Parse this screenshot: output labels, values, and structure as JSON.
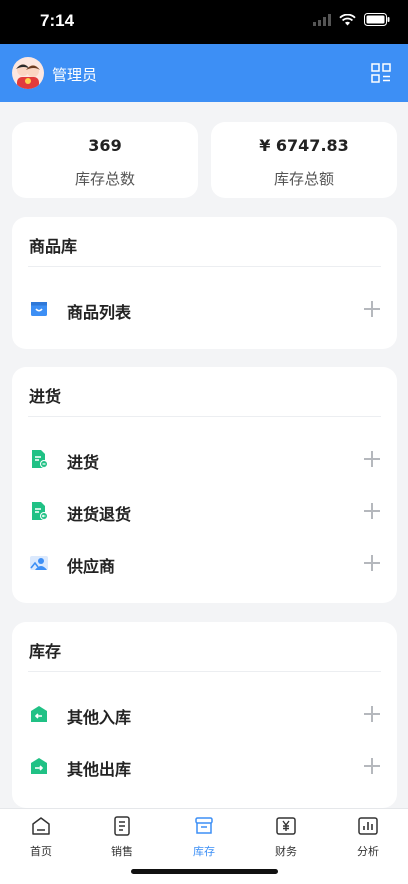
{
  "status_bar": {
    "time": "7:14"
  },
  "header": {
    "user_name": "管理员"
  },
  "summary": {
    "stock_total_value": "369",
    "stock_total_label": "库存总数",
    "stock_amount_value": "¥ 6747.83",
    "stock_amount_label": "库存总额"
  },
  "sections": [
    {
      "title": "商品库",
      "items": [
        {
          "label": "商品列表",
          "icon": "shopping-bag-icon"
        }
      ]
    },
    {
      "title": "进货",
      "items": [
        {
          "label": "进货",
          "icon": "purchase-doc-icon"
        },
        {
          "label": "进货退货",
          "icon": "purchase-return-doc-icon"
        },
        {
          "label": "供应商",
          "icon": "supplier-icon"
        }
      ]
    },
    {
      "title": "库存",
      "items": [
        {
          "label": "其他入库",
          "icon": "stock-in-icon"
        },
        {
          "label": "其他出库",
          "icon": "stock-out-icon"
        }
      ]
    }
  ],
  "tabs": [
    {
      "label": "首页",
      "icon": "home-icon"
    },
    {
      "label": "销售",
      "icon": "sales-doc-icon"
    },
    {
      "label": "库存",
      "icon": "inventory-box-icon",
      "active": true
    },
    {
      "label": "财务",
      "icon": "finance-yen-icon"
    },
    {
      "label": "分析",
      "icon": "analysis-chart-icon"
    }
  ],
  "colors": {
    "primary": "#3d8ff5",
    "green": "#20c185",
    "background": "#f3f4f6",
    "plus_gray": "#b5b8bd"
  }
}
